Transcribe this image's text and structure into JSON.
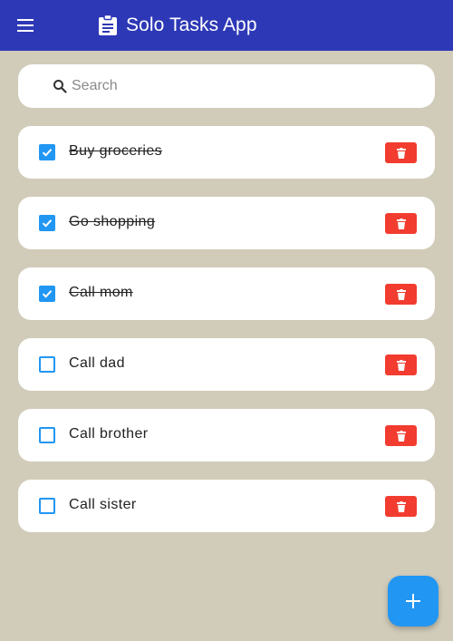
{
  "app_bar": {
    "title": "Solo Tasks App",
    "menu_icon": "menu-icon",
    "title_icon": "clipboard-icon",
    "background": "#2d38b6"
  },
  "search": {
    "placeholder": "Search",
    "value": "",
    "icon": "search-icon"
  },
  "tasks": [
    {
      "label": "Buy groceries",
      "checked": true
    },
    {
      "label": "Go shopping",
      "checked": true
    },
    {
      "label": "Call mom",
      "checked": true
    },
    {
      "label": "Call dad",
      "checked": false
    },
    {
      "label": "Call brother",
      "checked": false
    },
    {
      "label": "Call sister",
      "checked": false
    }
  ],
  "delete_icon": "trash-icon",
  "fab": {
    "icon": "plus-icon"
  },
  "colors": {
    "background": "#d1cbb9",
    "accent": "#2196f3",
    "delete": "#f23c2f"
  }
}
